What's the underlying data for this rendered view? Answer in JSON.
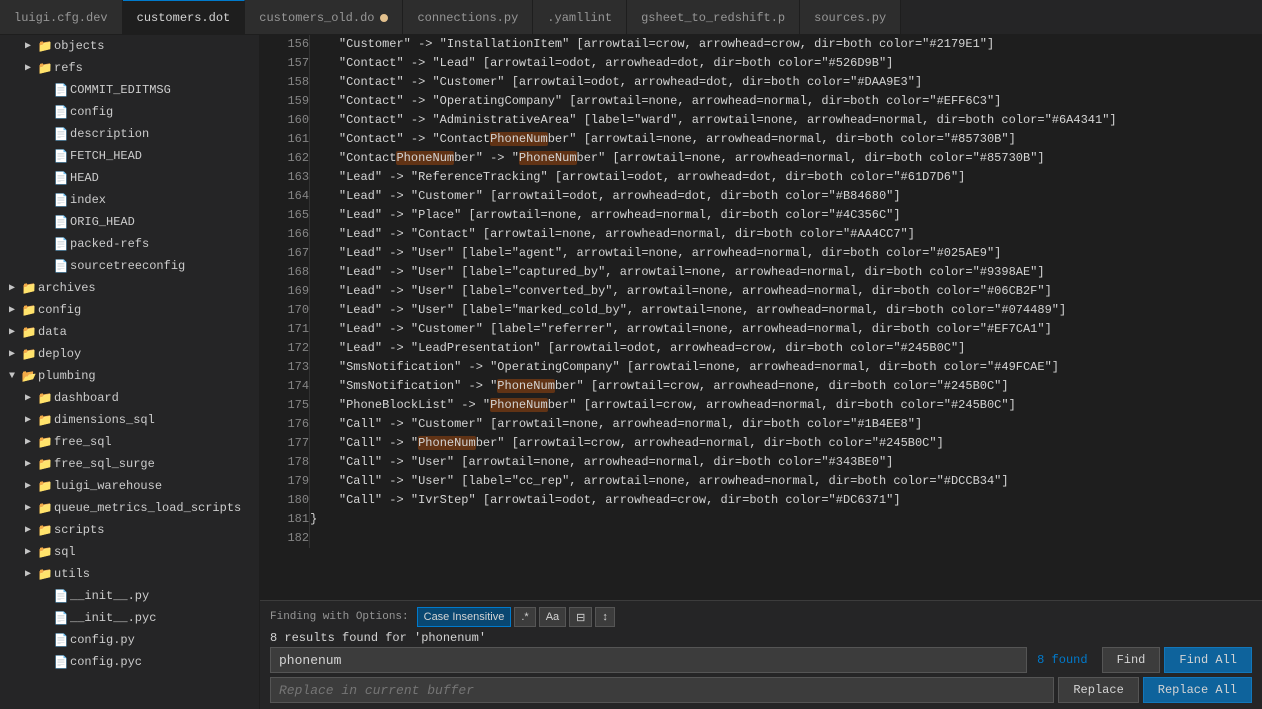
{
  "tabs": [
    {
      "id": "luigi-cfg",
      "label": "luigi.cfg.dev",
      "active": false,
      "modified": false
    },
    {
      "id": "customers-dot",
      "label": "customers.dot",
      "active": true,
      "modified": false
    },
    {
      "id": "customers-old",
      "label": "customers_old.do",
      "active": false,
      "modified": true
    },
    {
      "id": "connections",
      "label": "connections.py",
      "active": false,
      "modified": false
    },
    {
      "id": "yamllint",
      "label": ".yamllint",
      "active": false,
      "modified": false
    },
    {
      "id": "gsheet-redshift",
      "label": "gsheet_to_redshift.p",
      "active": false,
      "modified": false
    },
    {
      "id": "sources",
      "label": "sources.py",
      "active": false,
      "modified": false
    }
  ],
  "sidebar": {
    "items": [
      {
        "id": "objects",
        "label": "objects",
        "type": "folder",
        "indent": 1,
        "expanded": false,
        "level": 1
      },
      {
        "id": "refs",
        "label": "refs",
        "type": "folder",
        "indent": 1,
        "expanded": false,
        "level": 1
      },
      {
        "id": "COMMIT_EDITMSG",
        "label": "COMMIT_EDITMSG",
        "type": "file",
        "indent": 2,
        "level": 2
      },
      {
        "id": "config-file",
        "label": "config",
        "type": "file",
        "indent": 2,
        "level": 2
      },
      {
        "id": "description",
        "label": "description",
        "type": "file",
        "indent": 2,
        "level": 2
      },
      {
        "id": "FETCH_HEAD",
        "label": "FETCH_HEAD",
        "type": "file",
        "indent": 2,
        "level": 2
      },
      {
        "id": "HEAD",
        "label": "HEAD",
        "type": "file",
        "indent": 2,
        "level": 2
      },
      {
        "id": "index",
        "label": "index",
        "type": "file",
        "indent": 2,
        "level": 2
      },
      {
        "id": "ORIG_HEAD",
        "label": "ORIG_HEAD",
        "type": "file",
        "indent": 2,
        "level": 2
      },
      {
        "id": "packed-refs",
        "label": "packed-refs",
        "type": "file",
        "indent": 2,
        "level": 2
      },
      {
        "id": "sourcetreeconfig",
        "label": "sourcetreeconfig",
        "type": "file",
        "indent": 2,
        "level": 2
      },
      {
        "id": "archives",
        "label": "archives",
        "type": "folder",
        "indent": 0,
        "expanded": false,
        "level": 0
      },
      {
        "id": "config",
        "label": "config",
        "type": "folder",
        "indent": 0,
        "expanded": false,
        "level": 0
      },
      {
        "id": "data",
        "label": "data",
        "type": "folder",
        "indent": 0,
        "expanded": false,
        "level": 0
      },
      {
        "id": "deploy",
        "label": "deploy",
        "type": "folder",
        "indent": 0,
        "expanded": false,
        "level": 0
      },
      {
        "id": "plumbing",
        "label": "plumbing",
        "type": "folder",
        "indent": 0,
        "expanded": true,
        "level": 0
      },
      {
        "id": "dashboard",
        "label": "dashboard",
        "type": "folder",
        "indent": 1,
        "expanded": false,
        "level": 1
      },
      {
        "id": "dimensions_sql",
        "label": "dimensions_sql",
        "type": "folder",
        "indent": 1,
        "expanded": false,
        "level": 1
      },
      {
        "id": "free_sql",
        "label": "free_sql",
        "type": "folder",
        "indent": 1,
        "expanded": false,
        "level": 1
      },
      {
        "id": "free_sql_surge",
        "label": "free_sql_surge",
        "type": "folder",
        "indent": 1,
        "expanded": false,
        "level": 1
      },
      {
        "id": "luigi_warehouse",
        "label": "luigi_warehouse",
        "type": "folder",
        "indent": 1,
        "expanded": false,
        "level": 1
      },
      {
        "id": "queue_metrics_load_scripts",
        "label": "queue_metrics_load_scripts",
        "type": "folder",
        "indent": 1,
        "expanded": false,
        "level": 1
      },
      {
        "id": "scripts",
        "label": "scripts",
        "type": "folder",
        "indent": 1,
        "expanded": false,
        "level": 1
      },
      {
        "id": "sql",
        "label": "sql",
        "type": "folder",
        "indent": 1,
        "expanded": false,
        "level": 1
      },
      {
        "id": "utils",
        "label": "utils",
        "type": "folder",
        "indent": 1,
        "expanded": false,
        "level": 1
      },
      {
        "id": "__init__py",
        "label": "__init__.py",
        "type": "file",
        "indent": 1,
        "level": 1
      },
      {
        "id": "__init__pyc",
        "label": "__init__.pyc",
        "type": "file",
        "indent": 1,
        "level": 1
      },
      {
        "id": "config-py",
        "label": "config.py",
        "type": "file",
        "indent": 1,
        "level": 1
      },
      {
        "id": "config-pyc",
        "label": "config.pyc",
        "type": "file",
        "indent": 1,
        "level": 1
      }
    ]
  },
  "code_lines": [
    {
      "num": 156,
      "content": "    \"Customer\" -> \"InstallationItem\" [arrowtail=crow, arrowhead=crow, dir=both color=\"#2179E1\"]"
    },
    {
      "num": 157,
      "content": "    \"Contact\" -> \"Lead\" [arrowtail=odot, arrowhead=dot, dir=both color=\"#526D9B\"]"
    },
    {
      "num": 158,
      "content": "    \"Contact\" -> \"Customer\" [arrowtail=odot, arrowhead=dot, dir=both color=\"#DAA9E3\"]"
    },
    {
      "num": 159,
      "content": "    \"Contact\" -> \"OperatingCompany\" [arrowtail=none, arrowhead=normal, dir=both color=\"#EFF6C3\"]"
    },
    {
      "num": 160,
      "content": "    \"Contact\" -> \"AdministrativeArea\" [label=\"ward\", arrowtail=none, arrowhead=normal, dir=both color=\"#6A4341\"]"
    },
    {
      "num": 161,
      "content": "    \"Contact\" -> \"ContactPhoneNumber\" [arrowtail=none, arrowhead=normal, dir=both color=\"#85730B\"]"
    },
    {
      "num": 162,
      "content": "    \"ContactPhoneNumber\" -> \"PhoneNumber\" [arrowtail=none, arrowhead=normal, dir=both color=\"#85730B\"]"
    },
    {
      "num": 163,
      "content": "    \"Lead\" -> \"ReferenceTracking\" [arrowtail=odot, arrowhead=dot, dir=both color=\"#61D7D6\"]"
    },
    {
      "num": 164,
      "content": "    \"Lead\" -> \"Customer\" [arrowtail=odot, arrowhead=dot, dir=both color=\"#B84680\"]"
    },
    {
      "num": 165,
      "content": "    \"Lead\" -> \"Place\" [arrowtail=none, arrowhead=normal, dir=both color=\"#4C356C\"]"
    },
    {
      "num": 166,
      "content": "    \"Lead\" -> \"Contact\" [arrowtail=none, arrowhead=normal, dir=both color=\"#AA4CC7\"]"
    },
    {
      "num": 167,
      "content": "    \"Lead\" -> \"User\" [label=\"agent\", arrowtail=none, arrowhead=normal, dir=both color=\"#025AE9\"]"
    },
    {
      "num": 168,
      "content": "    \"Lead\" -> \"User\" [label=\"captured_by\", arrowtail=none, arrowhead=normal, dir=both color=\"#9398AE\"]"
    },
    {
      "num": 169,
      "content": "    \"Lead\" -> \"User\" [label=\"converted_by\", arrowtail=none, arrowhead=normal, dir=both color=\"#06CB2F\"]"
    },
    {
      "num": 170,
      "content": "    \"Lead\" -> \"User\" [label=\"marked_cold_by\", arrowtail=none, arrowhead=normal, dir=both color=\"#074489\"]"
    },
    {
      "num": 171,
      "content": "    \"Lead\" -> \"Customer\" [label=\"referrer\", arrowtail=none, arrowhead=normal, dir=both color=\"#EF7CA1\"]"
    },
    {
      "num": 172,
      "content": "    \"Lead\" -> \"LeadPresentation\" [arrowtail=odot, arrowhead=crow, dir=both color=\"#245B0C\"]"
    },
    {
      "num": 173,
      "content": "    \"SmsNotification\" -> \"OperatingCompany\" [arrowtail=none, arrowhead=normal, dir=both color=\"#49FCAE\"]"
    },
    {
      "num": 174,
      "content": "    \"SmsNotification\" -> \"PhoneNumber\" [arrowtail=crow, arrowhead=none, dir=both color=\"#245B0C\"]"
    },
    {
      "num": 175,
      "content": "    \"PhoneBlockList\" -> \"PhoneNumber\" [arrowtail=crow, arrowhead=normal, dir=both color=\"#245B0C\"]"
    },
    {
      "num": 176,
      "content": "    \"Call\" -> \"Customer\" [arrowtail=none, arrowhead=normal, dir=both color=\"#1B4EE8\"]"
    },
    {
      "num": 177,
      "content": "    \"Call\" -> \"PhoneNumber\" [arrowtail=crow, arrowhead=normal, dir=both color=\"#245B0C\"]"
    },
    {
      "num": 178,
      "content": "    \"Call\" -> \"User\" [arrowtail=none, arrowhead=normal, dir=both color=\"#343BE0\"]"
    },
    {
      "num": 179,
      "content": "    \"Call\" -> \"User\" [label=\"cc_rep\", arrowtail=none, arrowhead=normal, dir=both color=\"#DCCB34\"]"
    },
    {
      "num": 180,
      "content": "    \"Call\" -> \"IvrStep\" [arrowtail=odot, arrowhead=crow, dir=both color=\"#DC6371\"]"
    },
    {
      "num": 181,
      "content": "}"
    },
    {
      "num": 182,
      "content": ""
    }
  ],
  "find_bar": {
    "results_text": "8 results found for 'phonenum'",
    "search_value": "phonenum",
    "count_text": "8 found",
    "find_label": "Find",
    "find_all_label": "Find All",
    "replace_placeholder": "Replace in current buffer",
    "replace_label": "Replace",
    "replace_all_label": "Replace All",
    "options_label": "Finding with Options:",
    "option_case": "Case Insensitive",
    "option_regex": ".*",
    "option_aa": "Aa",
    "option_whole": "⊟",
    "option_wrap": "↕"
  }
}
